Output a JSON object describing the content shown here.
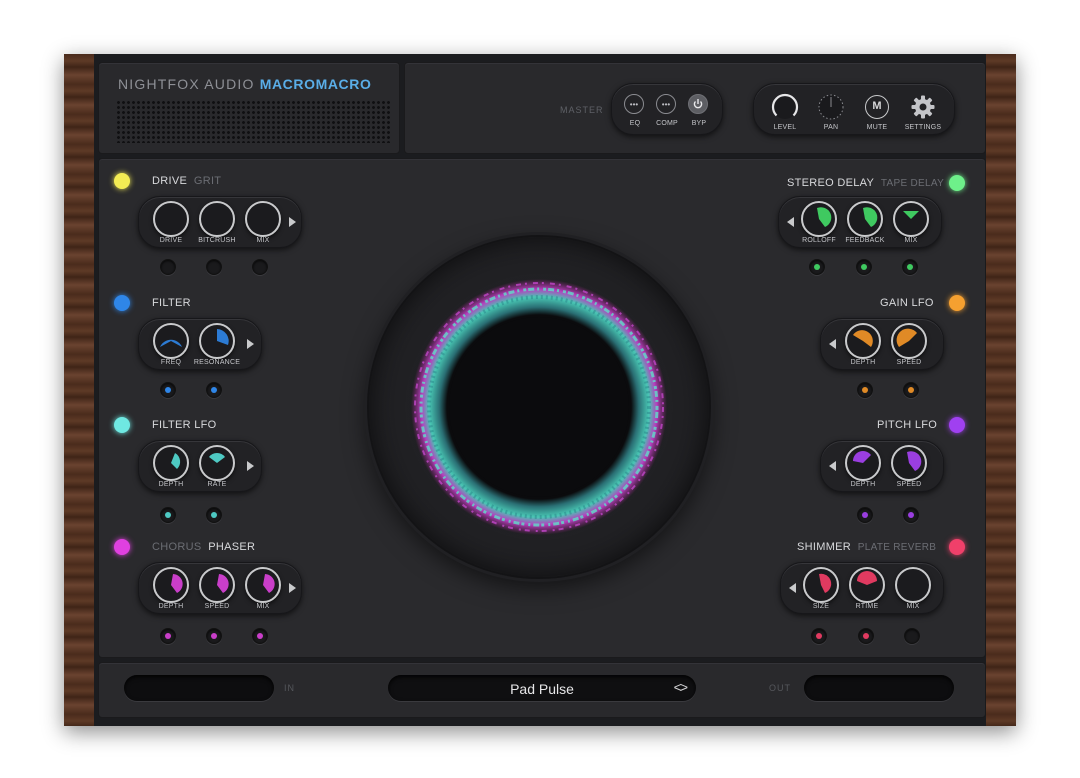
{
  "header": {
    "brand_prefix": "NIGHTFOX AUDIO",
    "brand_product": "MACROMACRO",
    "master_label": "MASTER",
    "master_buttons": [
      {
        "label": "EQ",
        "icon": "more-dots-icon"
      },
      {
        "label": "COMP",
        "icon": "more-dots-icon"
      },
      {
        "label": "BYP",
        "icon": "power-icon"
      }
    ],
    "output_controls": [
      {
        "label": "LEVEL",
        "icon": "knob-icon"
      },
      {
        "label": "PAN",
        "icon": "pan-knob-icon"
      },
      {
        "label": "MUTE",
        "icon": "mute-m-icon",
        "glyph": "M"
      },
      {
        "label": "SETTINGS",
        "icon": "gear-icon"
      }
    ]
  },
  "effects": {
    "drive": {
      "name": "DRIVE",
      "alt": "GRIT",
      "dot_color": "#f3ec54",
      "knobs": [
        "DRIVE",
        "BITCRUSH",
        "MIX"
      ],
      "accent": "#2a2a2d"
    },
    "filter": {
      "name": "FILTER",
      "dot_color": "#2f86e8",
      "knobs": [
        "FREQ",
        "RESONANCE"
      ],
      "accent": "#2f86e8"
    },
    "filter_lfo": {
      "name": "FILTER LFO",
      "dot_color": "#6fe8e2",
      "knobs": [
        "DEPTH",
        "RATE"
      ],
      "accent": "#4ec9c3"
    },
    "phaser": {
      "name": "PHASER",
      "alt": "CHORUS",
      "dot_color": "#e040e0",
      "knobs": [
        "DEPTH",
        "SPEED",
        "MIX"
      ],
      "accent": "#c93ec9"
    },
    "stereo_delay": {
      "name": "STEREO DELAY",
      "alt": "TAPE DELAY",
      "dot_color": "#6ef08a",
      "knobs": [
        "ROLLOFF",
        "FEEDBACK",
        "MIX"
      ],
      "accent": "#3fc960"
    },
    "gain_lfo": {
      "name": "GAIN LFO",
      "dot_color": "#f5a030",
      "knobs": [
        "DEPTH",
        "SPEED"
      ],
      "accent": "#e08a26"
    },
    "pitch_lfo": {
      "name": "PITCH LFO",
      "dot_color": "#a040f0",
      "knobs": [
        "DEPTH",
        "SPEED"
      ],
      "accent": "#9a3ee0"
    },
    "shimmer": {
      "name": "SHIMMER",
      "alt": "PLATE REVERB",
      "dot_color": "#f0406a",
      "knobs": [
        "SIZE",
        "RTIME",
        "MIX"
      ],
      "accent": "#e03a60"
    }
  },
  "footer": {
    "in_label": "IN",
    "out_label": "OUT",
    "preset_name": "Pad Pulse",
    "preset_nav": "<>"
  },
  "colors": {
    "brand_accent": "#5aaee8",
    "panel": "#29292c",
    "knob_ring": "#c9cacc"
  }
}
